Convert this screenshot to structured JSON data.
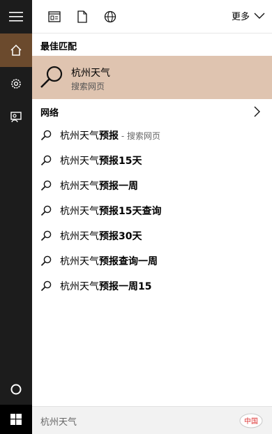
{
  "colors": {
    "rail_bg": "#1c1c1c",
    "active_bg": "#6b4a2d",
    "best_match_bg": "#dfc4b0",
    "search_box_bg": "#f2f2f2"
  },
  "rail": {
    "items": [
      "hamburger-menu",
      "home",
      "settings",
      "feedback",
      "cortana-circle",
      "windows-start"
    ]
  },
  "topbar": {
    "more_label": "更多"
  },
  "best_match": {
    "heading": "最佳匹配",
    "title": "杭州天气",
    "subtitle": "搜索网页"
  },
  "web": {
    "heading": "网络",
    "items": [
      {
        "prefix": "杭州天气",
        "bold": "预报",
        "extra": " - 搜索网页"
      },
      {
        "prefix": "杭州天气",
        "bold": "预报15天",
        "extra": ""
      },
      {
        "prefix": "杭州天气",
        "bold": "预报一周",
        "extra": ""
      },
      {
        "prefix": "杭州天气",
        "bold": "预报15天查询",
        "extra": ""
      },
      {
        "prefix": "杭州天气",
        "bold": "预报30天",
        "extra": ""
      },
      {
        "prefix": "杭州天气",
        "bold": "预报查询一周",
        "extra": ""
      },
      {
        "prefix": "杭州天气",
        "bold": "预报一周15",
        "extra": ""
      }
    ]
  },
  "search": {
    "query": "杭州天气",
    "brand_text": "中国"
  }
}
